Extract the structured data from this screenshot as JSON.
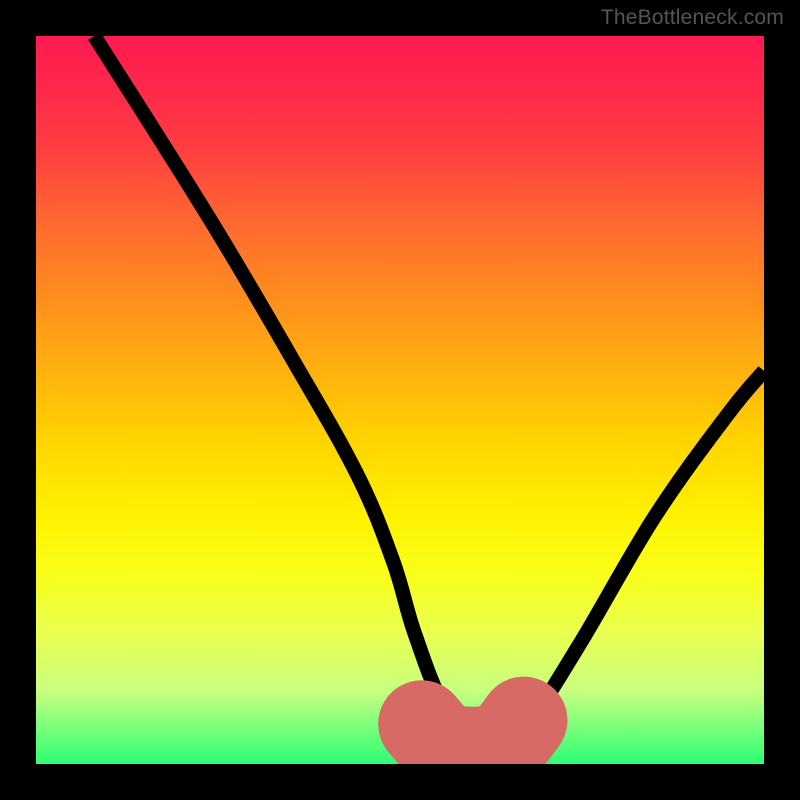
{
  "watermark": "TheBottleneck.com",
  "chart_data": {
    "type": "line",
    "title": "",
    "xlabel": "",
    "ylabel": "",
    "xlim": [
      0,
      100
    ],
    "ylim": [
      0,
      100
    ],
    "grid": false,
    "series": [
      {
        "name": "main-curve",
        "color": "#000000",
        "x": [
          8,
          15,
          25,
          35,
          44,
          49,
          52,
          56,
          61,
          64,
          68,
          75,
          85,
          95,
          100
        ],
        "y": [
          100,
          89,
          73,
          56,
          40,
          28,
          18,
          8,
          2,
          2,
          6,
          17,
          34,
          48,
          54
        ]
      },
      {
        "name": "highlight-hump",
        "color": "#d86a66",
        "x": [
          53,
          55,
          57,
          59,
          61,
          63,
          65,
          67
        ],
        "y": [
          5.5,
          3.3,
          2.2,
          1.9,
          1.9,
          2.3,
          3.5,
          6.0
        ]
      }
    ]
  }
}
